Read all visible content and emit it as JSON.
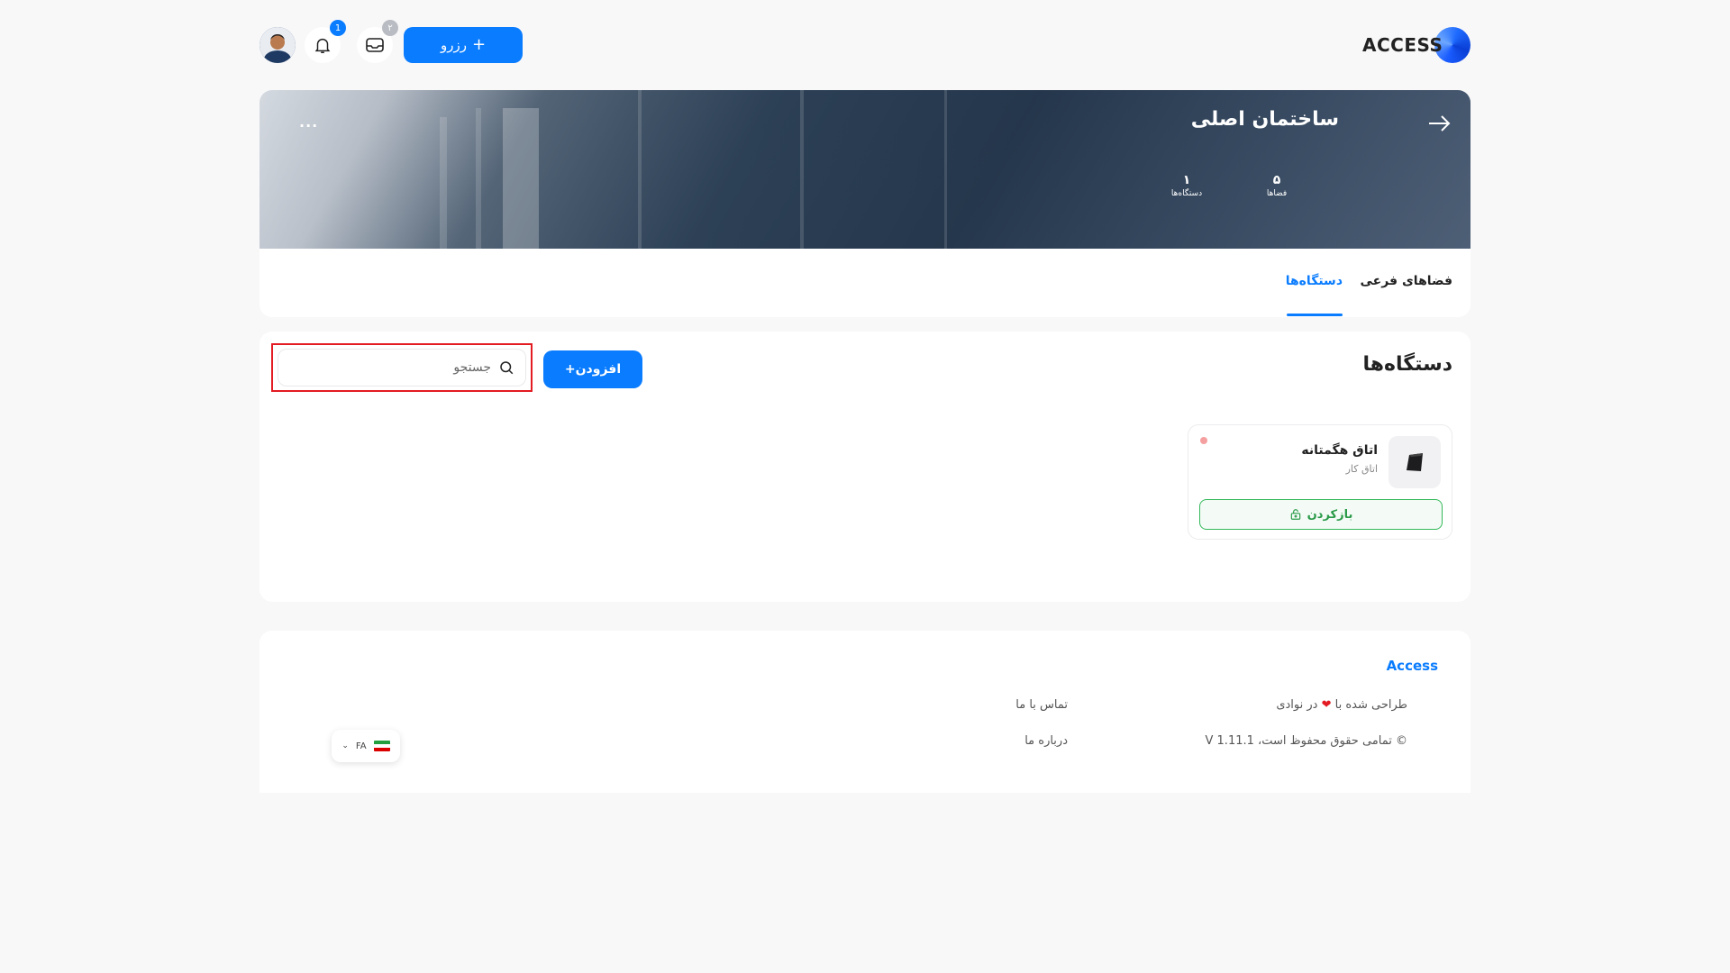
{
  "header": {
    "logo_text": "ACCESS",
    "reserve_label": "رزرو",
    "reserve_icon": "plus-icon",
    "inbox_badge": "۲",
    "notifications_badge": "1",
    "avatar_icon": "user-avatar"
  },
  "banner": {
    "title": "ساختمان اصلی",
    "back_icon": "arrow-right-icon",
    "more_label": "...",
    "stats": [
      {
        "value": "۵",
        "label": "فضاها"
      },
      {
        "value": "۱",
        "label": "دستگاه‌ها"
      }
    ]
  },
  "tabs": [
    {
      "label": "فضاهای فرعی",
      "active": false
    },
    {
      "label": "دستگاه‌ها",
      "active": true
    }
  ],
  "devices": {
    "heading": "دستگاه‌ها",
    "add_label": "افزودن+",
    "search_placeholder": "جستجو",
    "items": [
      {
        "name": "اتاق هگمتانه",
        "subtitle": "اتاق کار",
        "action_label": "بازکردن",
        "action_icon": "unlock-icon",
        "status_color": "#f5a0a0"
      }
    ]
  },
  "footer": {
    "brand": "Access",
    "designed_prefix": "طراحی شده با",
    "designed_suffix": "در نوادی",
    "heart_icon": "heart-icon",
    "copyright": "© تمامی حقوق محفوظ است، V 1.11.1",
    "contact": "تماس با ما",
    "about": "درباره ما",
    "lang_code": "FA",
    "lang_flag": "iran-flag-icon"
  },
  "colors": {
    "primary": "#0a7cff",
    "success": "#2a9a49",
    "danger": "#e31b23",
    "background": "#f8f8f9"
  }
}
